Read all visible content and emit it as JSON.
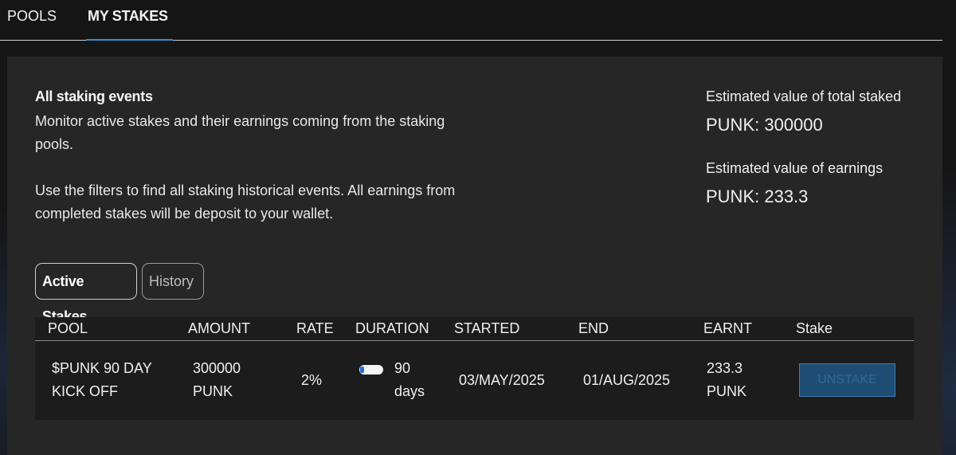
{
  "tabs": [
    {
      "label": "POOLS"
    },
    {
      "label": "MY STAKES"
    }
  ],
  "info": {
    "title": "All staking events",
    "paragraph1": "Monitor active stakes and their earnings coming from the staking pools.",
    "paragraph2": "Use the filters to find all staking historical events. All earnings from completed stakes will be deposit to your wallet."
  },
  "estimates": {
    "total_label": "Estimated value of total staked",
    "total_value": "PUNK: 300000",
    "earnings_label": "Estimated value of earnings",
    "earnings_value": "PUNK: 233.3"
  },
  "filters": {
    "active": "Active Stakes",
    "history": "History"
  },
  "table": {
    "headers": [
      "POOL",
      "AMOUNT",
      "RATE",
      "DURATION",
      "STARTED",
      "END",
      "EARNT",
      "Stake"
    ],
    "row": {
      "pool_line1": "$PUNK 90 DAY",
      "pool_line2": "KICK OFF",
      "amount_line1": "300000",
      "amount_line2": "PUNK",
      "rate": "2%",
      "duration_line1": "90",
      "duration_line2": "days",
      "started": "03/MAY/2025",
      "end": "01/AUG/2025",
      "earnt_line1": "233.3",
      "earnt_line2": "PUNK",
      "action": "UNSTAKE"
    }
  },
  "colors": {
    "accent": "#2f8fd6",
    "panel": "#262626",
    "button": "#1f4c73"
  }
}
